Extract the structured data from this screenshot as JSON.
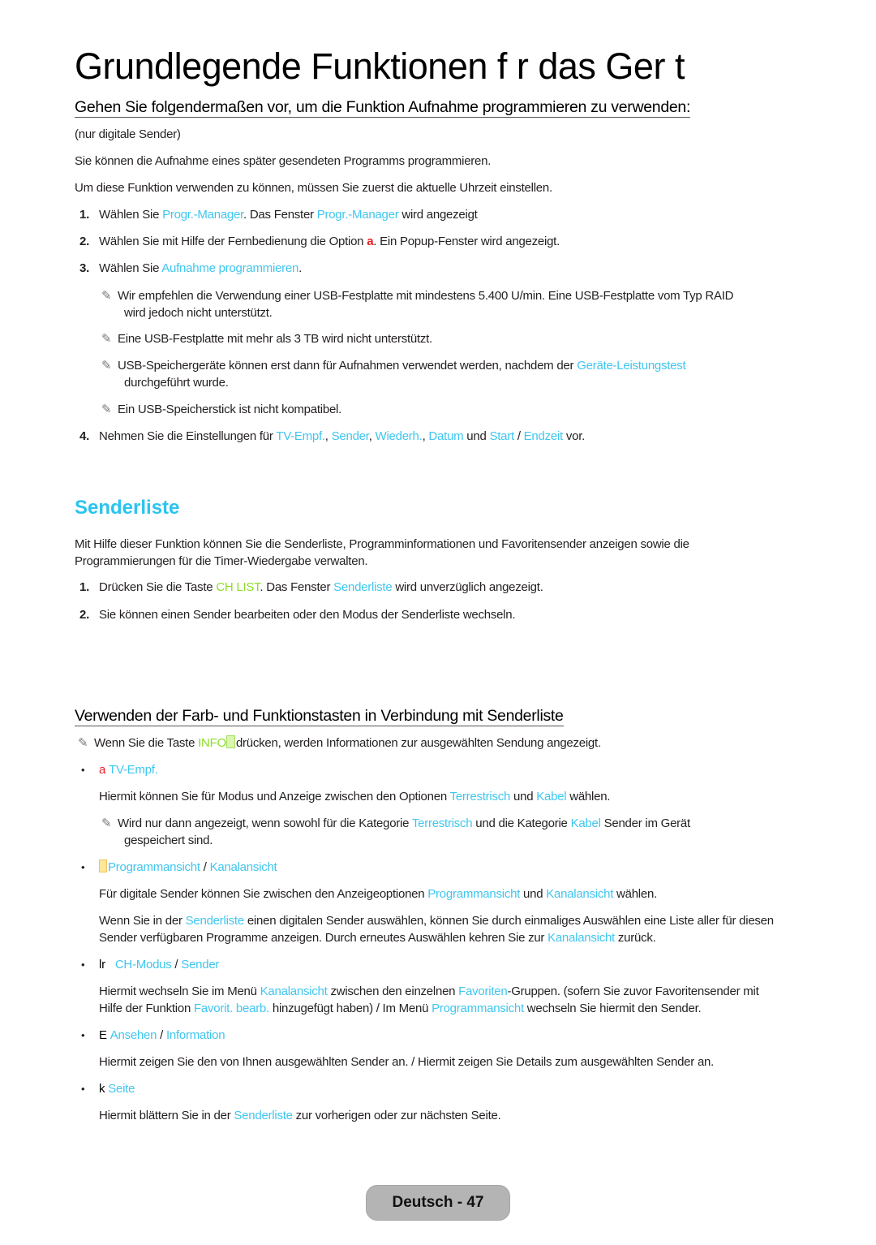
{
  "page": {
    "title": "Grundlegende Funktionen f r das Ger t"
  },
  "record_section": {
    "heading": "Gehen Sie folgendermaßen vor, um die Funktion Aufnahme programmieren zu verwenden:",
    "scope_note": "(nur digitale Sender)",
    "intro": "Sie können die Aufnahme eines später gesendeten Programms programmieren.",
    "time_note": "Um diese Funktion verwenden zu können, müssen Sie zuerst die aktuelle Uhrzeit einstellen.",
    "steps": [
      {
        "num": "1.",
        "t1": "Wählen Sie ",
        "h1": "Progr.-Manager",
        "t2": ". Das Fenster ",
        "h2": "Progr.-Manager",
        "t3": " wird angezeigt"
      },
      {
        "num": "2.",
        "t1": "Wählen Sie mit Hilfe der Fernbedienung die Option ",
        "key": "a",
        "t2": ". Ein Popup-Fenster wird angezeigt."
      },
      {
        "num": "3.",
        "t1": "Wählen Sie ",
        "h1": "Aufnahme programmieren",
        "t2": "."
      },
      {
        "num": "4.",
        "t1": "Nehmen Sie die Einstellungen für ",
        "h1": "TV-Empf.",
        "s1": ", ",
        "h2": "Sender",
        "s2": ", ",
        "h3": "Wiederh.",
        "s3": ", ",
        "h4": "Datum",
        "s4": " und ",
        "h5": "Start",
        "s5": " / ",
        "h6": "Endzeit",
        "t2": " vor."
      }
    ],
    "notes": [
      {
        "line1": "Wir empfehlen die Verwendung einer USB-Festplatte mit mindestens 5.400 U/min. Eine USB-Festplatte vom Typ RAID",
        "line2": "wird jedoch nicht unterstützt."
      },
      {
        "line1": "Eine USB-Festplatte mit mehr als 3 TB wird nicht unterstützt."
      },
      {
        "line1a": "USB-Speichergeräte können erst dann für Aufnahmen verwendet werden, nachdem der ",
        "h1": "Geräte-Leistungstest",
        "line2": "durchgeführt wurde."
      },
      {
        "line1": "Ein USB-Speicherstick ist nicht kompatibel."
      }
    ]
  },
  "senderliste": {
    "title": "Senderliste",
    "intro_line1": "Mit Hilfe dieser Funktion können Sie die Senderliste, Programminformationen und Favoritensender anzeigen sowie die",
    "intro_line2": "Programmierungen für die Timer-Wiedergabe verwalten.",
    "steps": [
      {
        "num": "1.",
        "t1": "Drücken Sie die Taste ",
        "g1": "CH LIST",
        "t2": ". Das Fenster ",
        "h1": "Senderliste",
        "t3": " wird unverzüglich angezeigt."
      },
      {
        "num": "2.",
        "t1": "Sie können einen Sender bearbeiten oder den Modus der Senderliste wechseln."
      }
    ]
  },
  "color_keys": {
    "heading": "Verwenden der Farb- und Funktionstasten in Verbindung mit Senderliste",
    "info_note": {
      "t1": "Wenn Sie die Taste ",
      "g1": "INFO",
      "t2": "drücken, werden Informationen zur ausgewählten Sendung angezeigt."
    },
    "items": [
      {
        "key": "a",
        "h1": "TV-Empf.",
        "desc": {
          "t1": "Hiermit können Sie für Modus und Anzeige zwischen den Optionen ",
          "h1": "Terrestrisch",
          "t2": " und ",
          "h2": "Kabel",
          "t3": " wählen."
        },
        "note": {
          "t1": "Wird nur dann angezeigt, wenn sowohl für die Kategorie ",
          "h1": "Terrestrisch",
          "t2": " und die Kategorie ",
          "h2": "Kabel",
          "t3": " Sender im Gerät",
          "line2": "gespeichert sind."
        }
      },
      {
        "h1": "Programmansicht",
        "sep": " / ",
        "h2": "Kanalansicht",
        "desc": {
          "t1": "Für digitale Sender können Sie zwischen den Anzeigeoptionen ",
          "h1": "Programmansicht",
          "t2": " und ",
          "h2": "Kanalansicht",
          "t3": " wählen."
        },
        "desc2": {
          "t1": "Wenn Sie in der ",
          "h1": "Senderliste",
          "t2": " einen digitalen Sender auswählen, können Sie durch einmaliges Auswählen eine Liste aller für diesen",
          "line2a": "Sender verfügbaren Programme anzeigen. Durch erneutes Auswählen kehren Sie zur ",
          "h2": "Kanalansicht",
          "t3": " zurück."
        }
      },
      {
        "key": "lr",
        "h1": "CH-Modus",
        "sep": " / ",
        "h2": "Sender",
        "desc": {
          "t1": "Hiermit wechseln Sie im Menü ",
          "h1": "Kanalansicht",
          "t2": " zwischen den einzelnen ",
          "h2": "Favoriten",
          "t3": "-Gruppen. (sofern Sie zuvor Favoritensender mit",
          "line2a": "Hilfe der Funktion ",
          "h3": "Favorit. bearb.",
          "t4": " hinzugefügt haben) / Im Menü ",
          "h4": "Programmansicht",
          "t5": " wechseln Sie hiermit den Sender."
        }
      },
      {
        "key": "E",
        "h1": "Ansehen",
        "sep": " / ",
        "h2": "Information",
        "desc": {
          "t1": "Hiermit zeigen Sie den von Ihnen ausgewählten Sender an. / Hiermit zeigen Sie Details zum ausgewählten Sender an."
        }
      },
      {
        "key": "k",
        "h1": "Seite",
        "desc": {
          "t1": "Hiermit blättern Sie in der ",
          "h1": "Senderliste",
          "t2": " zur vorherigen oder zur nächsten Seite."
        }
      }
    ]
  },
  "footer": {
    "page_label": "Deutsch - 47"
  },
  "icons": {
    "note": "✎",
    "bullet": "•"
  }
}
